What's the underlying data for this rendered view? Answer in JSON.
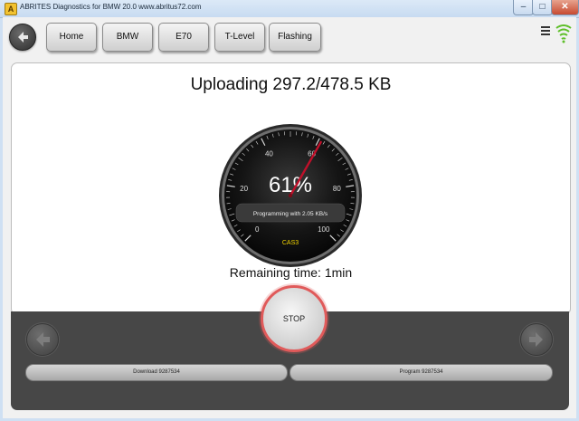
{
  "window": {
    "title": "ABRITES Diagnostics for BMW 20.0   www.abritus72.com",
    "app_icon_letter": "A",
    "minimize_glyph": "–",
    "maximize_glyph": "□",
    "close_glyph": "✕"
  },
  "toolbar": {
    "nav": [
      "Home",
      "BMW",
      "E70",
      "T-Level",
      "Flashing"
    ]
  },
  "panel": {
    "title": "Uploading 297.2/478.5 KB",
    "remaining": "Remaining time: 1min"
  },
  "gauge": {
    "percent_label": "61%",
    "percent": 61,
    "status": "Programming with 2.05 KB/s",
    "module": "CAS3",
    "ticks": [
      "0",
      "20",
      "40",
      "60",
      "80",
      "100"
    ],
    "needle_color": "#c0102a",
    "module_color": "#f2d400"
  },
  "actions": {
    "stop_label": "STOP",
    "download_label": "Download 9287534",
    "program_label": "Program 9287534"
  },
  "colors": {
    "stop_ring": "#e05a5a",
    "dark_panel": "#474747"
  }
}
